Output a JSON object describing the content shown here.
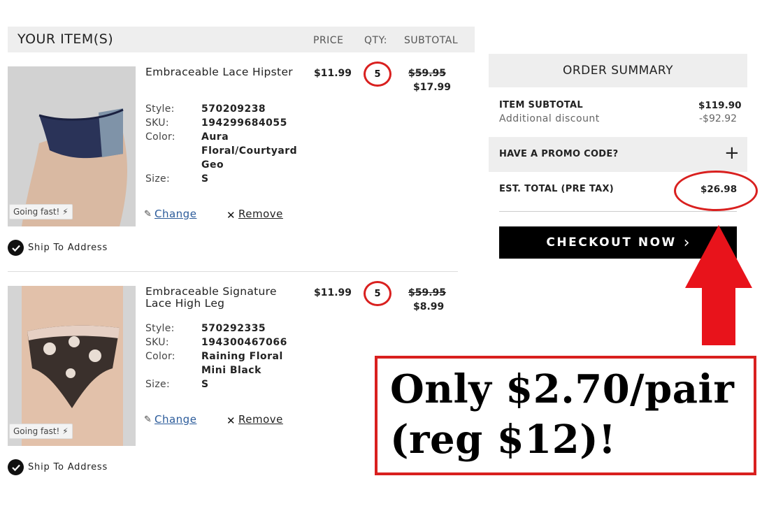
{
  "cart": {
    "title": "YOUR ITEM(S)",
    "col_price": "PRICE",
    "col_qty": "QTY:",
    "col_subtotal": "SUBTOTAL"
  },
  "items": [
    {
      "name": "Embraceable Lace Hipster",
      "style_label": "Style:",
      "style": "570209238",
      "sku_label": "SKU:",
      "sku": "194299684055",
      "color_label": "Color:",
      "color": "Aura Floral/Courtyard Geo",
      "size_label": "Size:",
      "size": "S",
      "price": "$11.99",
      "qty": "5",
      "old_subtotal": "$59.95",
      "subtotal": "$17.99",
      "badge": "Going fast!",
      "change": "Change",
      "remove": "Remove",
      "ship": "Ship To Address"
    },
    {
      "name": "Embraceable Signature Lace High Leg",
      "style_label": "Style:",
      "style": "570292335",
      "sku_label": "SKU:",
      "sku": "194300467066",
      "color_label": "Color:",
      "color": "Raining Floral Mini Black",
      "size_label": "Size:",
      "size": "S",
      "price": "$11.99",
      "qty": "5",
      "old_subtotal": "$59.95",
      "subtotal": "$8.99",
      "badge": "Going fast!",
      "change": "Change",
      "remove": "Remove",
      "ship": "Ship To Address"
    }
  ],
  "summary": {
    "title": "ORDER SUMMARY",
    "item_subtotal_label": "ITEM SUBTOTAL",
    "item_subtotal": "$119.90",
    "discount_label": "Additional discount",
    "discount": "-$92.92",
    "promo_label": "HAVE A PROMO CODE?",
    "promo_icon": "+",
    "total_label": "EST. TOTAL (PRE TAX)",
    "total": "$26.98",
    "checkout": "CHECKOUT NOW",
    "checkout_icon": "›"
  },
  "annotation": {
    "line1": "Only $2.70/pair",
    "line2": "(reg $12)!",
    "accent": "#d9201f"
  }
}
